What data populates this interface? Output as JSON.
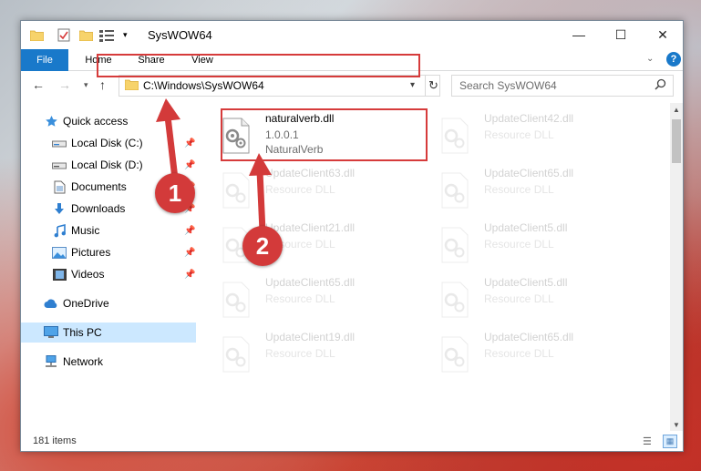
{
  "window": {
    "title": "SysWOW64",
    "controls": {
      "minimize": "—",
      "maximize": "☐",
      "close": "✕"
    }
  },
  "ribbon": {
    "tabs": [
      "File",
      "Home",
      "Share",
      "View"
    ],
    "help": "?"
  },
  "address": {
    "path": "C:\\Windows\\SysWOW64",
    "search_placeholder": "Search SysWOW64"
  },
  "navigation": {
    "items": [
      {
        "label": "Quick access",
        "icon": "star-icon",
        "pinned": false
      },
      {
        "label": "Local Disk (C:)",
        "icon": "drive-icon",
        "pinned": true
      },
      {
        "label": "Local Disk (D:)",
        "icon": "drive-icon",
        "pinned": true
      },
      {
        "label": "Documents",
        "icon": "documents-icon",
        "pinned": true
      },
      {
        "label": "Downloads",
        "icon": "download-arrow-icon",
        "pinned": true
      },
      {
        "label": "Music",
        "icon": "music-note-icon",
        "pinned": true
      },
      {
        "label": "Pictures",
        "icon": "pictures-icon",
        "pinned": true
      },
      {
        "label": "Videos",
        "icon": "videos-icon",
        "pinned": true
      },
      {
        "label": "OneDrive",
        "icon": "cloud-icon",
        "pinned": false
      },
      {
        "label": "This PC",
        "icon": "computer-icon",
        "pinned": false,
        "selected": true
      },
      {
        "label": "Network",
        "icon": "network-icon",
        "pinned": false
      }
    ]
  },
  "files": [
    {
      "name": "naturalverb.dll",
      "version": "1.0.0.1",
      "description": "NaturalVerb",
      "highlighted": true
    },
    {
      "name": "UpdateClient42.dll",
      "description": "Resource DLL"
    },
    {
      "name": "UpdateClient63.dll",
      "description": "Resource DLL"
    },
    {
      "name": "UpdateClient65.dll",
      "description": "Resource DLL"
    },
    {
      "name": "UpdateClient21.dll",
      "description": "Resource DLL"
    },
    {
      "name": "UpdateClient5.dll",
      "description": "Resource DLL"
    },
    {
      "name": "UpdateClient65.dll",
      "description": "Resource DLL"
    },
    {
      "name": "UpdateClient5.dll",
      "description": "Resource DLL"
    },
    {
      "name": "UpdateClient19.dll",
      "description": "Resource DLL"
    },
    {
      "name": "UpdateClient65.dll",
      "description": "Resource DLL"
    }
  ],
  "status": {
    "item_count": "181 items"
  },
  "callouts": {
    "step1": "1",
    "step2": "2"
  },
  "colors": {
    "accent": "#1979ca",
    "highlight": "#d63b3b",
    "selected": "#cce8ff"
  }
}
